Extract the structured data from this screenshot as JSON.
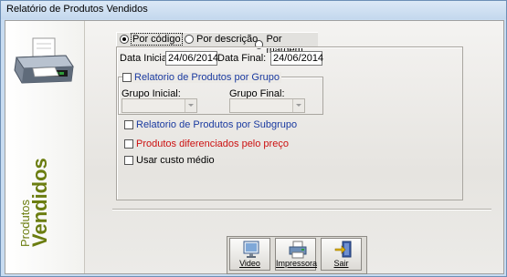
{
  "window": {
    "title": "Relatório de Produtos Vendidos"
  },
  "side_panel": {
    "line1": "Produtos",
    "line2": "Vendidos",
    "color": "#6b7d10"
  },
  "order_options": [
    {
      "label": "Por código",
      "selected": true
    },
    {
      "label": "Por descrição",
      "selected": false
    },
    {
      "label": "Por margem",
      "selected": false
    }
  ],
  "dates": {
    "start_label": "Data Inicial:",
    "start_value": "24/06/2014",
    "end_label": "Data Final:",
    "end_value": "24/06/2014"
  },
  "group_report": {
    "label": "Relatorio de Produtos por Grupo",
    "checked": false,
    "group_start_label": "Grupo Inicial:",
    "group_end_label": "Grupo Final:",
    "group_start_value": "",
    "group_end_value": ""
  },
  "checkboxes": {
    "subgroup": {
      "label": "Relatorio de Produtos por Subgrupo",
      "checked": false
    },
    "price_diff": {
      "label": "Produtos  diferenciados pelo preço",
      "checked": false
    },
    "avg_cost": {
      "label": "Usar custo médio",
      "checked": false
    }
  },
  "buttons": {
    "video": {
      "label": "Video",
      "icon": "monitor-icon"
    },
    "print": {
      "label": "Impressora",
      "icon": "printer-icon"
    },
    "exit": {
      "label": "Sair",
      "icon": "exit-door-icon"
    }
  },
  "colors": {
    "label_blue": "#1a3aa0",
    "label_red": "#cc1010"
  }
}
